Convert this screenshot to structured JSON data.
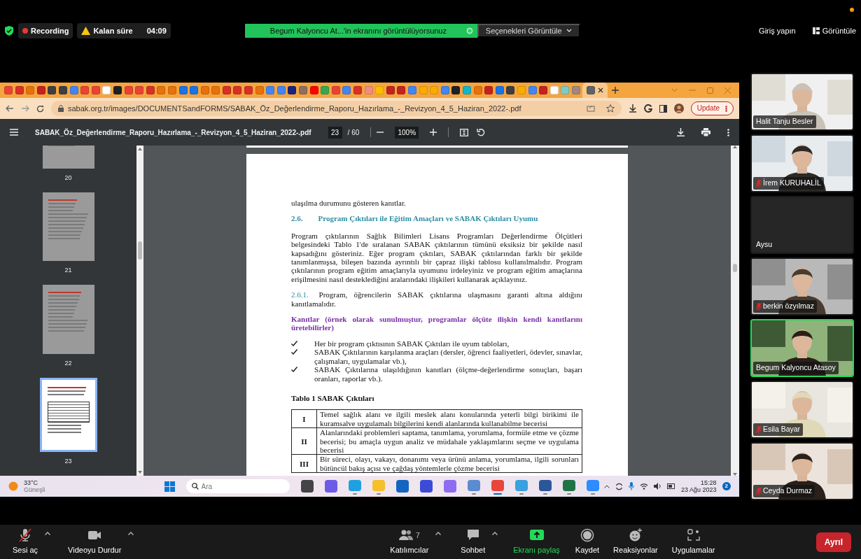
{
  "zoom_top_bar": {
    "recording_label": "Recording",
    "timer_label": "Kalan süre",
    "timer_value": "04:09",
    "share_banner": "Begum Kalyoncu At...'in ekranını görüntülüyorsunuz",
    "view_options": "Seçenekleri Görüntüle",
    "sign_in": "Giriş yapın",
    "view": "Görüntüle"
  },
  "browser": {
    "tabs": [
      {
        "color": "#ea4335",
        "selected": false
      },
      {
        "color": "#d93025",
        "selected": false
      },
      {
        "color": "#e8710a",
        "selected": false
      },
      {
        "color": "#c5221f",
        "selected": false
      },
      {
        "color": "#3c4043",
        "selected": false
      },
      {
        "color": "#3c4043",
        "selected": false
      },
      {
        "color": "#4285f4",
        "selected": false
      },
      {
        "color": "#ea4335",
        "selected": false
      },
      {
        "color": "#ea4335",
        "selected": false
      },
      {
        "color": "#ffffff",
        "selected": false
      },
      {
        "color": "#202124",
        "selected": false
      },
      {
        "color": "#ea4335",
        "selected": false
      },
      {
        "color": "#ea4335",
        "selected": false
      },
      {
        "color": "#d93025",
        "selected": false
      },
      {
        "color": "#e8710a",
        "selected": false
      },
      {
        "color": "#e8710a",
        "selected": false
      },
      {
        "color": "#1a73e8",
        "selected": false
      },
      {
        "color": "#1a73e8",
        "selected": false
      },
      {
        "color": "#e8710a",
        "selected": false
      },
      {
        "color": "#e8710a",
        "selected": false
      },
      {
        "color": "#d93025",
        "selected": false
      },
      {
        "color": "#d93025",
        "selected": false
      },
      {
        "color": "#d93025",
        "selected": false
      },
      {
        "color": "#e8710a",
        "selected": false
      },
      {
        "color": "#4285f4",
        "selected": false
      },
      {
        "color": "#4285f4",
        "selected": false
      },
      {
        "color": "#1a237e",
        "selected": false
      },
      {
        "color": "#8d6e63",
        "selected": false
      },
      {
        "color": "#ff0000",
        "selected": false
      },
      {
        "color": "#34a853",
        "selected": false
      },
      {
        "color": "#ea4335",
        "selected": false
      },
      {
        "color": "#4285f4",
        "selected": false
      },
      {
        "color": "#d93025",
        "selected": false
      },
      {
        "color": "#f28b82",
        "selected": false
      },
      {
        "color": "#fbbc04",
        "selected": false
      },
      {
        "color": "#c5221f",
        "selected": false
      },
      {
        "color": "#c5221f",
        "selected": false
      },
      {
        "color": "#4285f4",
        "selected": false
      },
      {
        "color": "#f9ab00",
        "selected": false
      },
      {
        "color": "#f9ab00",
        "selected": false
      },
      {
        "color": "#4285f4",
        "selected": false
      },
      {
        "color": "#202124",
        "selected": false
      },
      {
        "color": "#12b5cb",
        "selected": false
      },
      {
        "color": "#e8710a",
        "selected": false
      },
      {
        "color": "#c5221f",
        "selected": false
      },
      {
        "color": "#1a73e8",
        "selected": false
      },
      {
        "color": "#3c4043",
        "selected": false
      },
      {
        "color": "#f9ab00",
        "selected": false
      },
      {
        "color": "#4285f4",
        "selected": false
      },
      {
        "color": "#c5221f",
        "selected": false
      },
      {
        "color": "#ffffff",
        "selected": false
      },
      {
        "color": "#80cbc4",
        "selected": false
      },
      {
        "color": "#a1887f",
        "selected": false
      },
      {
        "color": "#5f6368",
        "selected": true
      }
    ],
    "url": "sabak.org.tr/images/DOCUMENTSandFORMS/SABAK_Öz_Değerlendirme_Raporu_Hazırlama_-_Revizyon_4_5_Haziran_2022-.pdf",
    "update_button": "Update"
  },
  "pdf_viewer": {
    "title": "SABAK_Öz_Değerlendirme_Raporu_Hazırlama_-_Revizyon_4_5_Haziran_2022-.pdf",
    "page_input": "23",
    "page_total": "/ 60",
    "zoom": "100%",
    "thumbnails": [
      {
        "label": "20",
        "selected": false
      },
      {
        "label": "21",
        "selected": false
      },
      {
        "label": "22",
        "selected": false
      },
      {
        "label": "23",
        "selected": true
      }
    ],
    "document": [
      {
        "kind": "text",
        "text": "ulaşılma durumunu gösteren kanıtlar."
      },
      {
        "kind": "heading",
        "number": "2.6.",
        "text": "Program Çıktıları ile Eğitim Amaçları ve SABAK Çıktıları Uyumu"
      },
      {
        "kind": "paragraph",
        "text": "Program çıktılarının Sağlık Bilimleri Lisans Programları Değerlendirme Ölçütleri belgesindeki Tablo 1'de sıralanan SABAK çıktılarının tümünü eksiksiz bir şekilde nasıl kapsadığını gösteriniz. Eğer program çıktıları, SABAK çıktılarından farklı bir şekilde tanımlanmışsa, bileşen bazında ayrıntılı bir çapraz ilişki tablosu kullanılmalıdır. Program çıktılarının program eğitim amaçlarıyla uyumunu irdeleyiniz ve program eğitim amaçlarına erişilmesini nasıl desteklediğini aralarındaki ilişkileri kullanarak açıklayınız."
      },
      {
        "kind": "numbered",
        "number": "2.6.1.",
        "text": "Program, öğrencilerin SABAK çıktılarına ulaşmasını garanti altına aldığını kanıtlamalıdır."
      },
      {
        "kind": "evidence",
        "text": "Kanıtlar (örnek olarak sunulmuştur, programlar ölçüte ilişkin kendi kanıtlarını üretebilirler)"
      },
      {
        "kind": "check",
        "text": "Her bir program çıktısının SABAK Çıktıları ile uyum tabloları,"
      },
      {
        "kind": "check",
        "text": "SABAK Çıktılarının karşılanma araçları (dersler, öğrenci faaliyetleri, ödevler, sınavlar, çalışmaları, uygulamalar vb.),"
      },
      {
        "kind": "check",
        "text": "SABAK Çıktılarına ulaşıldığının kanıtları (ölçme-değerlendirme sonuçları, başarı oranları, raporlar vb.)."
      },
      {
        "kind": "caption",
        "text": "Tablo 1 SABAK Çıktıları"
      },
      {
        "kind": "table",
        "rows": [
          {
            "number": "I",
            "text": "Temel sağlık alanı ve ilgili meslek alanı konularında yeterli bilgi birikimi ile kuramsalve uygulamalı bilgilerini kendi alanlarında kullanabilme becerisi"
          },
          {
            "number": "II",
            "text": "Alanlarındaki problemleri saptama, tanımlama, yorumlama, formüle etme ve çözme becerisi; bu amaçla uygun analiz ve müdahale yaklaşımlarını seçme ve uygulama becerisi"
          },
          {
            "number": "III",
            "text": "Bir süreci, olayı, vakayı, donanımı veya ürünü anlama, yorumlama, ilgili sorunları bütüncül bakış açısı ve çağdaş yöntemlerle çözme becerisi"
          }
        ]
      }
    ]
  },
  "taskbar": {
    "temperature": "33°C",
    "weather": "Güneşli",
    "search_placeholder": "Ara",
    "apps": [
      {
        "color": "#444444",
        "open": false,
        "selected": false
      },
      {
        "color": "#6c5ce7",
        "open": false,
        "selected": false
      },
      {
        "color": "#1fa0e0",
        "open": true,
        "selected": false
      },
      {
        "color": "#f4c02c",
        "open": true,
        "selected": false
      },
      {
        "color": "#1565c0",
        "open": false,
        "selected": false
      },
      {
        "color": "#3b4bd8",
        "open": false,
        "selected": false
      },
      {
        "color": "#8e6cf0",
        "open": false,
        "selected": false
      },
      {
        "color": "#5b8bd0",
        "open": true,
        "selected": false
      },
      {
        "color": "#e8453c",
        "open": true,
        "selected": true
      },
      {
        "color": "#3aa0e0",
        "open": true,
        "selected": false
      },
      {
        "color": "#2b579a",
        "open": true,
        "selected": false
      },
      {
        "color": "#217346",
        "open": true,
        "selected": false
      },
      {
        "color": "#2d8cff",
        "open": true,
        "selected": false
      }
    ],
    "time": "15:28",
    "date": "23 Ağu 2023",
    "notifications": "2"
  },
  "participants": [
    {
      "name": "Halit Tanju Besler",
      "muted": false,
      "video": true,
      "active": false
    },
    {
      "name": "İrem KURUHALİL",
      "muted": true,
      "video": true,
      "active": false
    },
    {
      "name": "Aysu",
      "muted": false,
      "video": false,
      "active": false
    },
    {
      "name": "berkin özyılmaz",
      "muted": true,
      "video": true,
      "active": false
    },
    {
      "name": "Begum Kalyoncu Atasoy",
      "muted": false,
      "video": true,
      "active": true
    },
    {
      "name": "Esila Bayar",
      "muted": true,
      "video": true,
      "active": false
    },
    {
      "name": "Ceyda Durmaz",
      "muted": true,
      "video": true,
      "active": false
    }
  ],
  "meeting_toolbar": {
    "items": [
      {
        "kind": "mic-muted",
        "label": "Sesi aç",
        "caret": true
      },
      {
        "kind": "video",
        "label": "Videoyu Durdur",
        "caret": true
      },
      {
        "kind": "participants",
        "label": "Katılımcılar",
        "count": "7",
        "caret": true
      },
      {
        "kind": "chat",
        "label": "Sohbet",
        "caret": true
      },
      {
        "kind": "share",
        "label": "Ekranı paylaş",
        "caret": false
      },
      {
        "kind": "record",
        "label": "Kaydet",
        "caret": false
      },
      {
        "kind": "reactions",
        "label": "Reaksiyonlar",
        "caret": false
      },
      {
        "kind": "apps",
        "label": "Uygulamalar",
        "caret": false
      }
    ],
    "leave_button": "Ayrıl"
  }
}
